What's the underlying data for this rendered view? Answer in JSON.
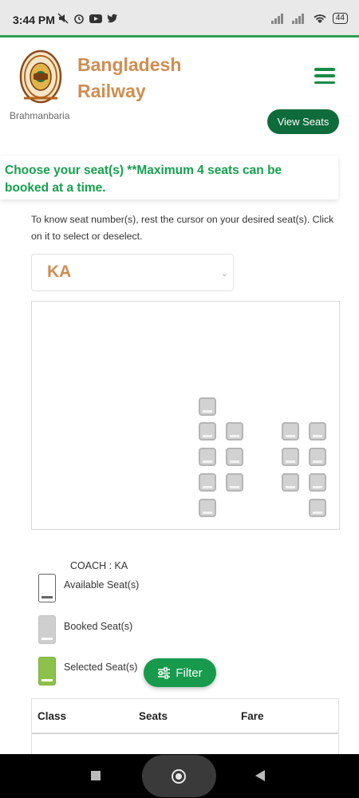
{
  "status_bar": {
    "time": "3:44 PM",
    "battery": "44"
  },
  "header": {
    "brand_line1": "Bangladesh",
    "brand_line2": "Railway",
    "menu_icon": "hamburger-icon",
    "colors": {
      "brand": "#d08d50",
      "accent": "#198b45"
    }
  },
  "behind": {
    "partial_text": "Brahmanbaria",
    "view_seats_label": "View Seats"
  },
  "notice": {
    "text": "Choose your seat(s) **Maximum 4 seats can be booked at a time."
  },
  "instructions": "To know seat number(s), rest the cursor on your desired seat(s). Click on it to select or deselect.",
  "coach_select": {
    "value": "KA"
  },
  "legend": {
    "coach_label": "COACH : KA",
    "available": "Available Seat(s)",
    "booked": "Booked Seat(s)",
    "selected": "Selected Seat(s)"
  },
  "filter": {
    "label": "Filter",
    "icon": "sliders-icon"
  },
  "fare_table": {
    "headers": [
      "Class",
      "Seats",
      "Fare"
    ]
  }
}
